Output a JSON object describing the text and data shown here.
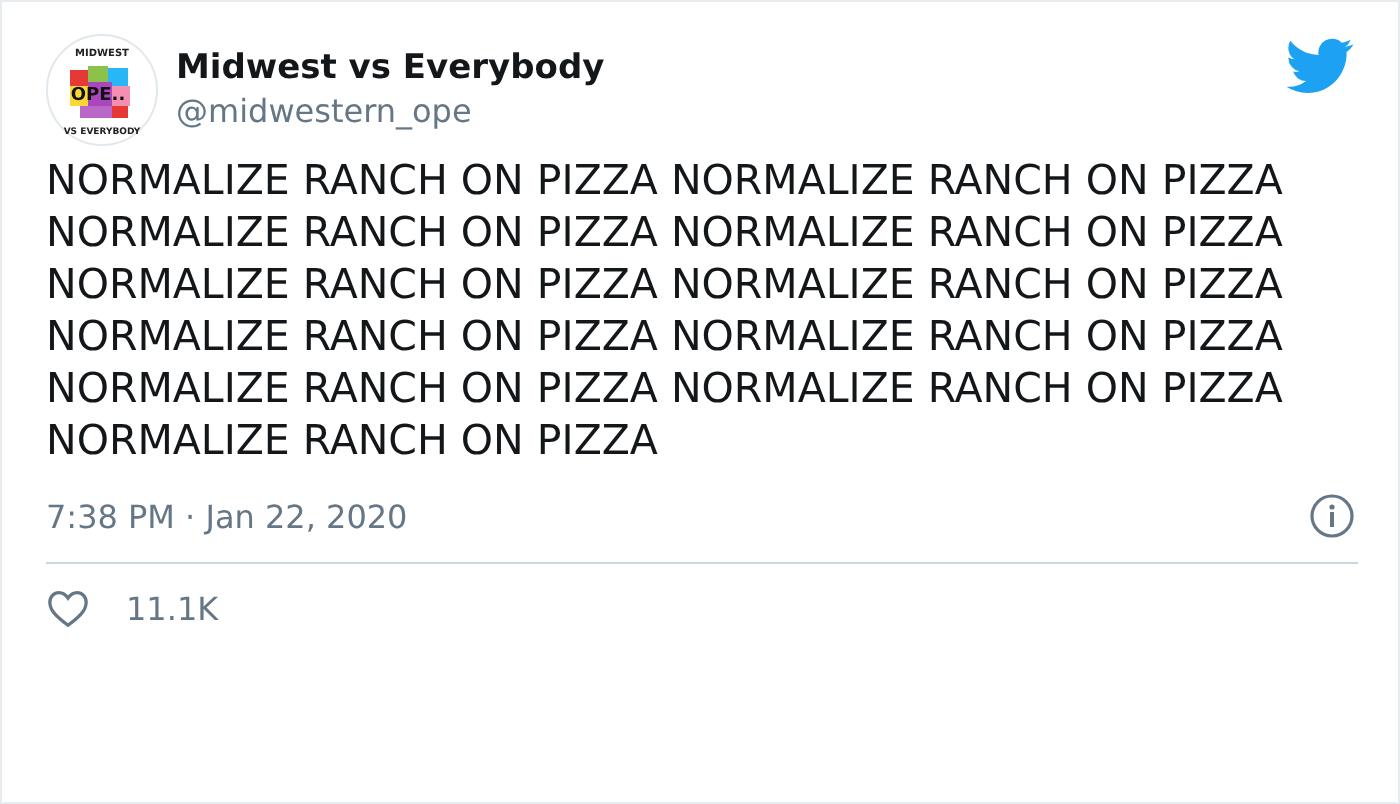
{
  "tweet": {
    "author": {
      "name": "Midwest vs Everybody",
      "handle": "@midwestern_ope",
      "avatar_texts": [
        "MIDWEST",
        "OPE..",
        "VS EVERYBODY"
      ]
    },
    "text": "NORMALIZE RANCH ON PIZZA NORMALIZE RANCH ON PIZZA NORMALIZE RANCH ON PIZZA NORMALIZE RANCH ON PIZZA NORMALIZE RANCH ON PIZZA NORMALIZE RANCH ON PIZZA NORMALIZE RANCH ON PIZZA NORMALIZE RANCH ON PIZZA NORMALIZE RANCH ON PIZZA NORMALIZE RANCH ON PIZZA NORMALIZE RANCH ON PIZZA",
    "timestamp": "7:38 PM · Jan 22, 2020",
    "likes": "11.1K"
  }
}
